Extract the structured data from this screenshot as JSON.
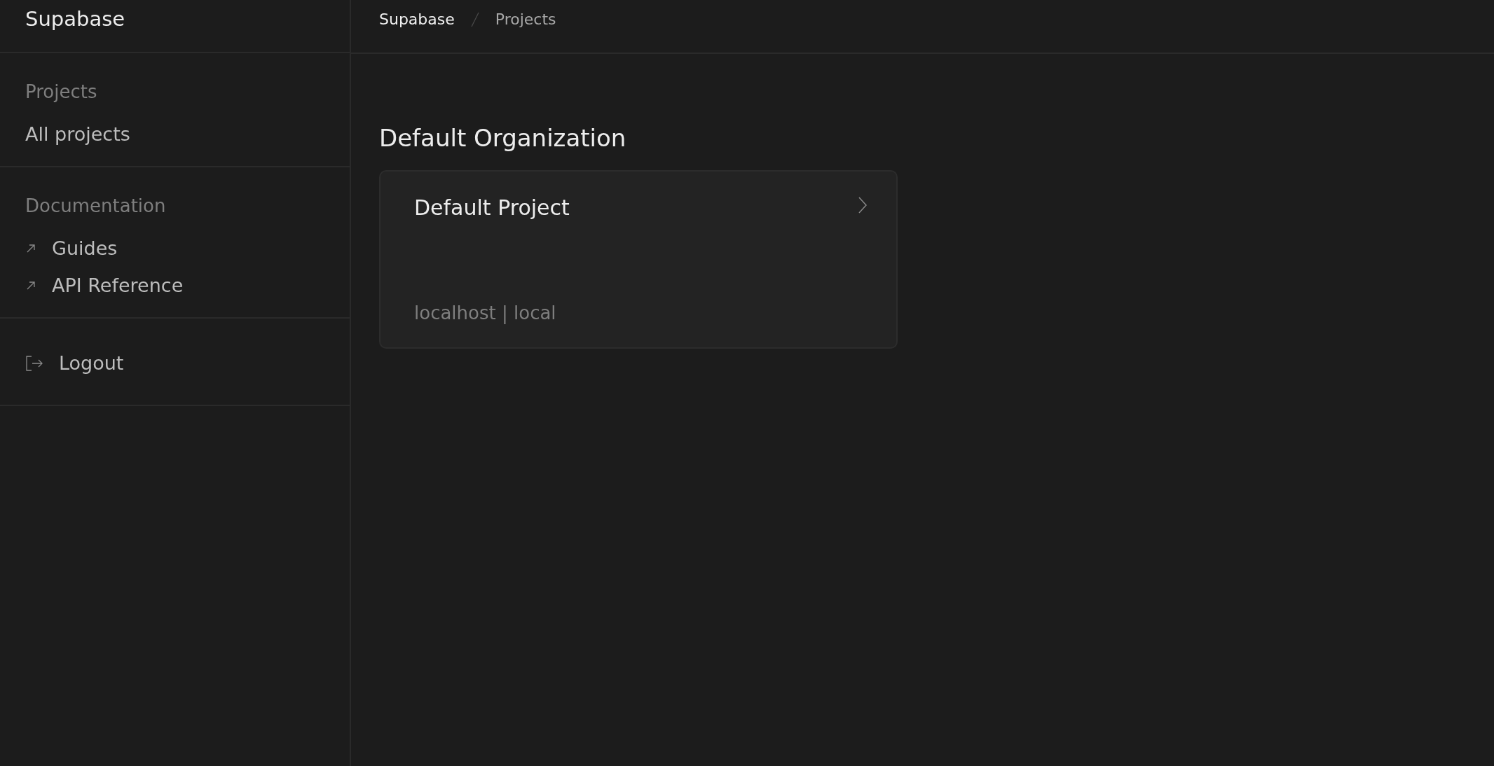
{
  "sidebar": {
    "title": "Supabase",
    "sections": [
      {
        "heading": "Projects",
        "items": [
          {
            "label": "All projects",
            "kind": "link"
          }
        ]
      },
      {
        "heading": "Documentation",
        "items": [
          {
            "label": "Guides",
            "kind": "external"
          },
          {
            "label": "API Reference",
            "kind": "external"
          }
        ]
      },
      {
        "items": [
          {
            "label": "Logout",
            "kind": "logout"
          }
        ]
      }
    ]
  },
  "breadcrumb": [
    {
      "label": "Supabase",
      "selected": false
    },
    {
      "label": "Projects",
      "selected": true
    }
  ],
  "organization": {
    "title": "Default Organization",
    "projects": [
      {
        "name": "Default Project",
        "details": "localhost | local"
      }
    ]
  }
}
